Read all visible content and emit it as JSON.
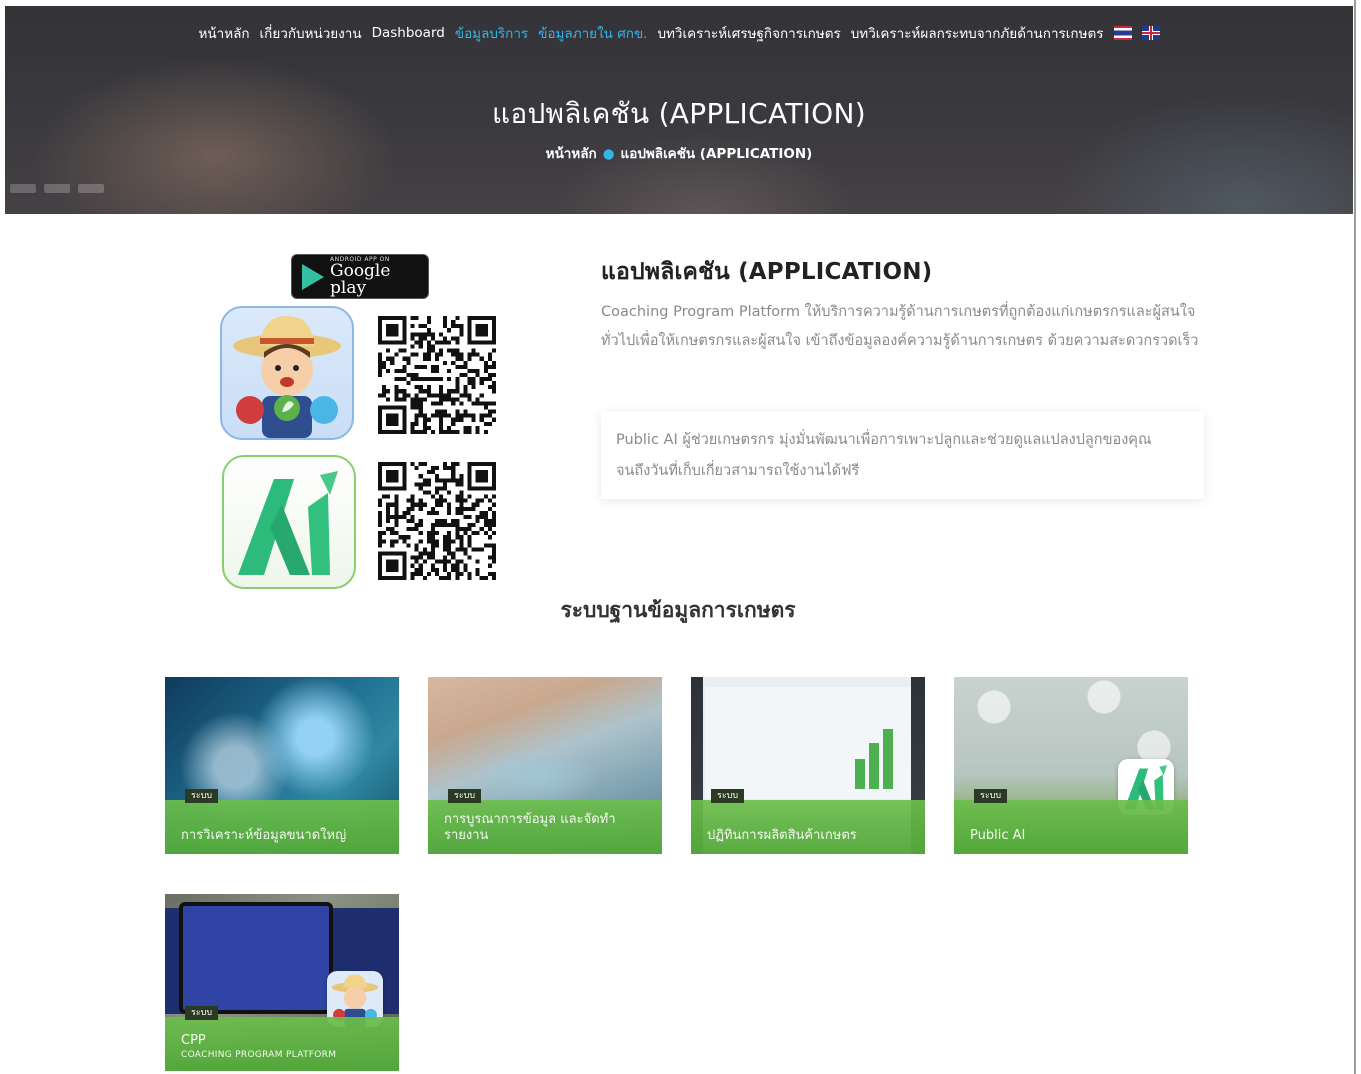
{
  "nav": {
    "items": [
      {
        "label": "หน้าหลัก",
        "active": false
      },
      {
        "label": "เกี่ยวกับหน่วยงาน",
        "active": false
      },
      {
        "label": "Dashboard",
        "active": false
      },
      {
        "label": "ข้อมูลบริการ",
        "active": true
      },
      {
        "label": "ข้อมูลภายใน ศกข.",
        "active": true
      },
      {
        "label": "บทวิเคราะห์เศรษฐกิจการเกษตร",
        "active": false
      },
      {
        "label": "บทวิเคราะห์ผลกระทบจากภัยด้านการเกษตร",
        "active": false
      }
    ],
    "accent_color": "#35b4e8"
  },
  "hero": {
    "title": "แอปพลิเคชัน (APPLICATION)",
    "breadcrumb_home": "หน้าหลัก",
    "breadcrumb_current": "แอปพลิเคชัน (APPLICATION)"
  },
  "store_badge": {
    "small": "ANDROID APP ON",
    "big": "Google play"
  },
  "app": {
    "heading": "แอปพลิเคชัน (APPLICATION)",
    "description": "Coaching Program Platform ให้บริการความรู้ด้านการเกษตรที่ถูกต้องแก่เกษตรกรและผู้สนใจทั่วไปเพื่อให้เกษตรกรและผู้สนใจ เข้าถึงข้อมูลองค์ความรู้ด้านการเกษตร ด้วยความสะดวกรวดเร็ว",
    "card_text": "Public AI ผู้ช่วยเกษตรกร มุ่งมั่นพัฒนาเพื่อการเพาะปลูกและช่วยดูแลแปลงปลูกของคุณ จนถึงวันที่เก็บเกี่ยวสามารถใช้งานได้ฟรี"
  },
  "section": {
    "title": "ระบบฐานข้อมูลการเกษตร"
  },
  "cards": [
    {
      "tag": "ระบบ",
      "label": "การวิเคราะห์ข้อมูลขนาดใหญ่",
      "sub": ""
    },
    {
      "tag": "ระบบ",
      "label": "การบูรณาการข้อมูล และจัดทำรายงาน",
      "sub": ""
    },
    {
      "tag": "ระบบ",
      "label": "ปฏิทินการผลิตสินค้าเกษตร",
      "sub": ""
    },
    {
      "tag": "ระบบ",
      "label": "Public AI",
      "sub": ""
    },
    {
      "tag": "ระบบ",
      "label": "CPP",
      "sub": "COACHING PROGRAM PLATFORM"
    }
  ],
  "colors": {
    "card_band": "#6cbe4c",
    "hero_bg": "#45444a"
  }
}
